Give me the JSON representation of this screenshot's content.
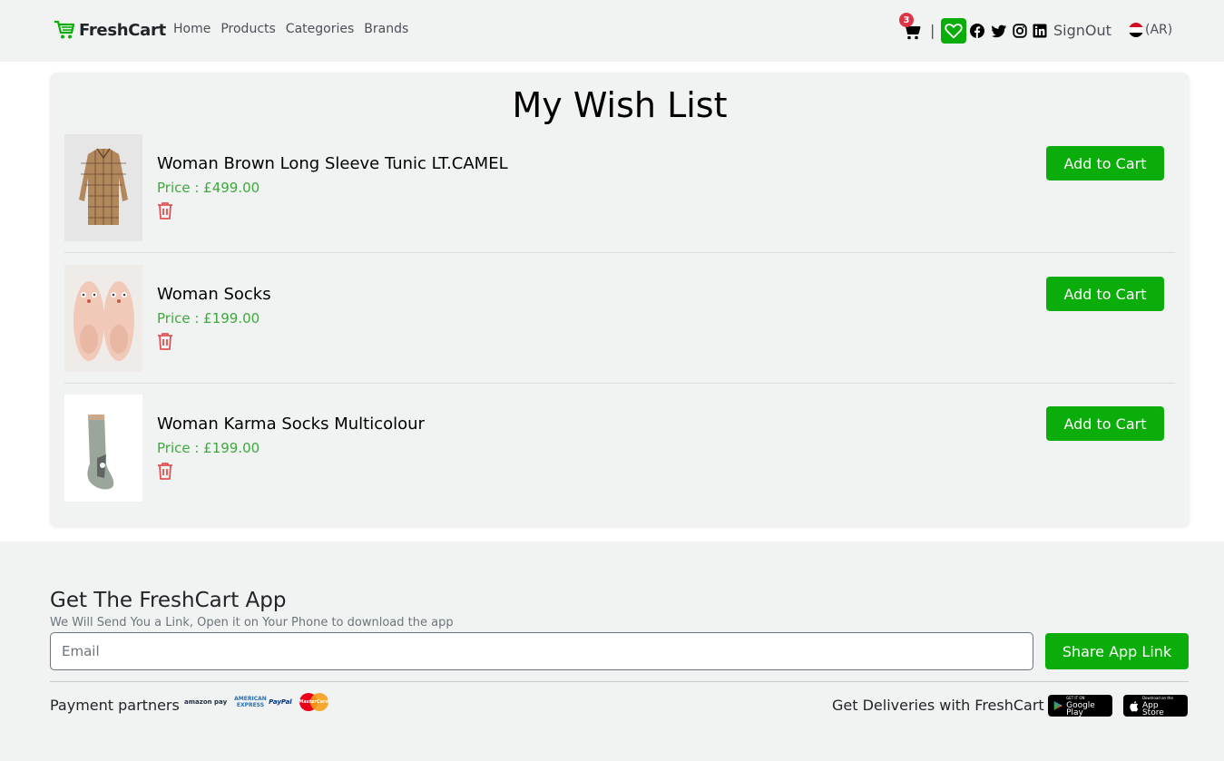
{
  "navbar": {
    "brand": "FreshCart",
    "links": [
      "Home",
      "Products",
      "Categories",
      "Brands"
    ],
    "cart_count": "3",
    "separator": "|",
    "signout": "SignOut",
    "lang": "(AR)",
    "icons": [
      "cart-icon",
      "heart-icon",
      "facebook-icon",
      "twitter-icon",
      "instagram-icon",
      "linkedin-icon"
    ]
  },
  "wishlist": {
    "title": "My Wish List",
    "items": [
      {
        "name": "Woman Brown Long Sleeve Tunic LT.CAMEL",
        "price": "Price : £499.00",
        "button": "Add to Cart"
      },
      {
        "name": "Woman Socks",
        "price": "Price : £199.00",
        "button": "Add to Cart"
      },
      {
        "name": "Woman Karma Socks Multicolour",
        "price": "Price : £199.00",
        "button": "Add to Cart"
      }
    ]
  },
  "footer": {
    "title": "Get The FreshCart App",
    "subtitle": "We Will Send You a Link, Open it on Your Phone to download the app",
    "email_placeholder": "Email",
    "share_button": "Share App Link",
    "payment_label": "Payment partners",
    "payment_logos": [
      "amazon pay",
      "AMERICAN EXPRESS",
      "PayPal",
      "MasterCard"
    ],
    "deliveries_label": "Get Deliveries with FreshCart",
    "google_play": {
      "small": "GET IT ON",
      "big": "Google Play"
    },
    "app_store": {
      "small": "Download on the",
      "big": "App Store"
    }
  },
  "colors": {
    "accent": "#0aad0a",
    "background": "#f0f3f2",
    "price": "#3ea83e",
    "danger": "#dc3545"
  }
}
